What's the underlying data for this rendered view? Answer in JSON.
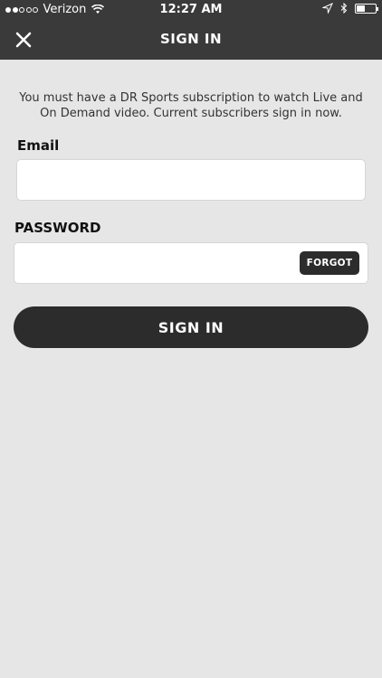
{
  "status_bar": {
    "carrier": "Verizon",
    "time": "12:27 AM",
    "signal_icon": "signal-dots-icon",
    "wifi_icon": "wifi-icon",
    "location_icon": "location-arrow-icon",
    "bluetooth_icon": "bluetooth-icon",
    "battery_icon": "battery-icon"
  },
  "navbar": {
    "title": "SIGN IN",
    "close_icon": "close-icon"
  },
  "form": {
    "info_text": "You must have a DR Sports subscription to watch Live and On Demand video. Current subscribers sign in now.",
    "email_label": "Email",
    "email_value": "",
    "password_label": "PASSWORD",
    "password_value": "",
    "forgot_label": "FORGOT",
    "signin_label": "SIGN IN"
  },
  "colors": {
    "header_bg": "#3a3a3a",
    "page_bg": "#e6e6e6",
    "button_bg": "#2c2c2c"
  }
}
